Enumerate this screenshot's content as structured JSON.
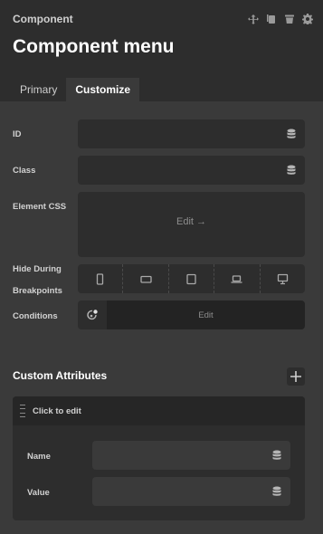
{
  "header": {
    "label": "Component",
    "title": "Component menu",
    "icons": [
      "link-icon",
      "copy-icon",
      "trash-icon",
      "gear-icon"
    ]
  },
  "tabs": [
    {
      "label": "Primary",
      "active": false
    },
    {
      "label": "Customize",
      "active": true
    }
  ],
  "fields": {
    "id": {
      "label": "ID",
      "value": ""
    },
    "class": {
      "label": "Class",
      "value": ""
    },
    "element_css": {
      "label": "Element CSS",
      "edit_label": "Edit →"
    },
    "hide_breakpoints": {
      "label_line1": "Hide During",
      "label_line2": "Breakpoints",
      "breakpoints": [
        "mobile-portrait-icon",
        "mobile-landscape-icon",
        "tablet-portrait-icon",
        "laptop-icon",
        "desktop-icon"
      ]
    },
    "conditions": {
      "label": "Conditions",
      "edit_label": "Edit"
    }
  },
  "custom_attributes": {
    "title": "Custom Attributes",
    "item": {
      "head_label": "Click to edit",
      "name_label": "Name",
      "name_value": "",
      "value_label": "Value",
      "value_value": ""
    }
  },
  "colors": {
    "background": "#3a3a3a",
    "header": "#2d2d2d",
    "field": "#2d2d2d",
    "accent": "#ffffff"
  }
}
